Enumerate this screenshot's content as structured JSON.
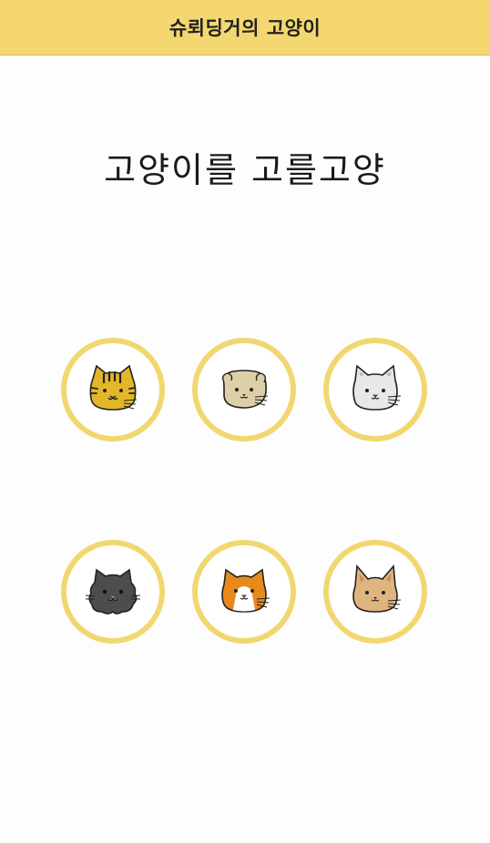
{
  "header": {
    "title": "슈뢰딩거의 고양이"
  },
  "main": {
    "title": "고양이를 고를고양"
  },
  "cats": [
    {
      "icon": "yellow-tabby-cat-icon",
      "color": "#e3b727"
    },
    {
      "icon": "cream-scottish-fold-cat-icon",
      "color": "#ddcfa7"
    },
    {
      "icon": "white-gray-cat-icon",
      "color": "#e8e8ea"
    },
    {
      "icon": "black-fluffy-cat-icon",
      "color": "#4d4d4f"
    },
    {
      "icon": "orange-white-calico-cat-icon",
      "color": "#e8891c"
    },
    {
      "icon": "tan-long-ear-cat-icon",
      "color": "#dfb57f"
    }
  ],
  "colors": {
    "header_bg": "#f4d771",
    "ring": "#f2d771",
    "background": "#fdfdfd"
  }
}
